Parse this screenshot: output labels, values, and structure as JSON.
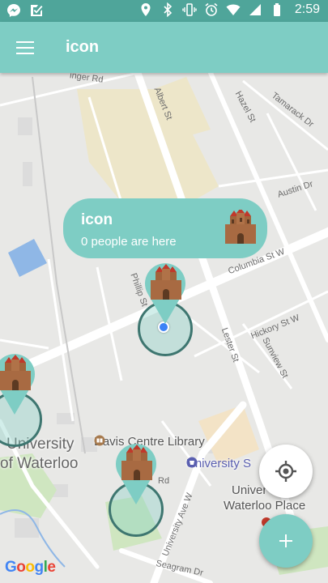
{
  "status_bar": {
    "time": "2:59",
    "left_icons": [
      "messenger-icon",
      "tasks-icon"
    ],
    "right_icons": [
      "location-icon",
      "bluetooth-icon",
      "vibrate-icon",
      "alarm-icon",
      "wifi-icon",
      "signal-icon",
      "battery-icon"
    ]
  },
  "app_bar": {
    "title": "icon",
    "menu_icon": "hamburger-menu-icon"
  },
  "bubble": {
    "name": "icon",
    "subtitle": "0 people are here",
    "icon": "castle-icon"
  },
  "map": {
    "street_labels": {
      "inger": "inger Rd",
      "albert": "Albert St",
      "hazel": "Hazel St",
      "tamarack": "Tamarack Dr",
      "austin": "Austin Dr",
      "columbia": "Columbia St W",
      "phillip": "Phillip St",
      "lester": "Lester St",
      "hickory": "Hickory St W",
      "sunview": "Sunview St",
      "rd": "Rd",
      "university_ave": "University Ave W",
      "seagram": "Seagram Dr"
    },
    "place_labels": {
      "university_line1": "University",
      "university_line2": "of Waterloo",
      "davis": "Davis Centre Library",
      "university_plaza": "University S",
      "waterloo_place_1": "Univer",
      "waterloo_place_2": "Waterloo Place"
    },
    "attribution": {
      "g1": "G",
      "g2": "o",
      "g3": "o",
      "g4": "g",
      "g5": "l",
      "g6": "e"
    }
  },
  "buttons": {
    "locate_icon": "my-location-icon",
    "add_icon": "add-icon"
  },
  "colors": {
    "accent": "#7ecdc4",
    "status_bar": "#4fa59a",
    "radius_stroke": "#3e7670"
  }
}
